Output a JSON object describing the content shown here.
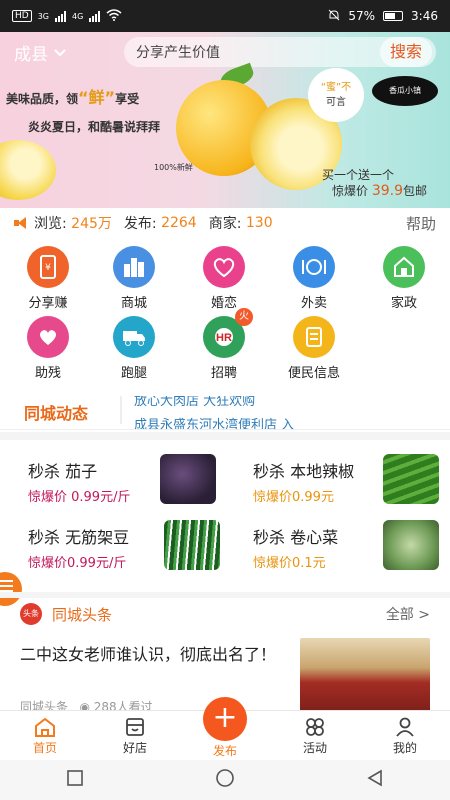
{
  "status_bar": {
    "network_badge": "HD",
    "net1": "3G",
    "net2": "4G",
    "battery": "57%",
    "time": "3:46"
  },
  "header": {
    "city": "成县",
    "search_placeholder": "分享产生价值",
    "search_button": "搜索"
  },
  "banner": {
    "line1_pre": "美味品质，领",
    "line1_highlight": "“鲜”",
    "line1_post": "享受",
    "line2": "炎炎夏日，和酷暑说拜拜",
    "fresh_tag": "100%新鲜",
    "bubble_pre": "“蜜”不",
    "bubble_post": "可言",
    "stamp_text": "香瓜小镇",
    "deal_line1": "买一个送一个",
    "deal_prefix": "惊爆价",
    "deal_price": "39.9",
    "deal_suffix": "包邮"
  },
  "stats": {
    "views_label": "浏览:",
    "views_value": "245万",
    "posts_label": "发布:",
    "posts_value": "2264",
    "merchants_label": "商家:",
    "merchants_value": "130",
    "help": "帮助"
  },
  "services": [
    {
      "label": "分享赚",
      "color": "#f0632a",
      "icon": "phone-share-icon"
    },
    {
      "label": "商城",
      "color": "#4a90e2",
      "icon": "city-building-icon"
    },
    {
      "label": "婚恋",
      "color": "#e9418b",
      "icon": "heart-icon"
    },
    {
      "label": "外卖",
      "color": "#3b8ee6",
      "icon": "dinner-plate-icon"
    },
    {
      "label": "家政",
      "color": "#4bbf5a",
      "icon": "house-icon"
    },
    {
      "label": "助残",
      "color": "#e74a8c",
      "icon": "care-heart-icon"
    },
    {
      "label": "跑腿",
      "color": "#23a6c9",
      "icon": "delivery-icon"
    },
    {
      "label": "招聘",
      "color": "#2fa15a",
      "icon": "hr-icon"
    },
    {
      "label": "便民信息",
      "color": "#f3b51a",
      "icon": "document-icon"
    }
  ],
  "hot_badge": "火",
  "news_ticker": {
    "tag": "同城动态",
    "line1": "放心大肉店 大狂欢购",
    "line2": "成县永盛东河水湾便利店 入"
  },
  "flash_sales": [
    {
      "title": "秒杀 茄子",
      "price": "惊爆价 0.99元/斤",
      "price_color": "#c2185b",
      "img_color": "#3b2a4a"
    },
    {
      "title": "秒杀 本地辣椒",
      "price": "惊爆价0.99元",
      "price_color": "#e8940f",
      "img_color": "#3a8a2a"
    },
    {
      "title": "秒杀 无筋架豆",
      "price": "惊爆价0.99元/斤",
      "price_color": "#c2185b",
      "img_color": "#2e7d32"
    },
    {
      "title": "秒杀 卷心菜",
      "price": "惊爆价0.1元",
      "price_color": "#e8940f",
      "img_color": "#6d9a55"
    }
  ],
  "headlines": {
    "logo": "头条",
    "title": "同城头条",
    "all": "全部 >",
    "article_title": "二中这女老师谁认识，彻底出名了！",
    "article_source": "同城头条",
    "article_views": "288人看过"
  },
  "tab_bar": [
    {
      "label": "首页",
      "icon": "home-icon",
      "active": true
    },
    {
      "label": "好店",
      "icon": "shop-icon",
      "active": false
    },
    {
      "label": "发布",
      "icon": "plus-icon",
      "active": false
    },
    {
      "label": "活动",
      "icon": "activity-icon",
      "active": false
    },
    {
      "label": "我的",
      "icon": "user-icon",
      "active": false
    }
  ],
  "colors": {
    "accent": "#f37b1d",
    "price_orange": "#f08319"
  }
}
